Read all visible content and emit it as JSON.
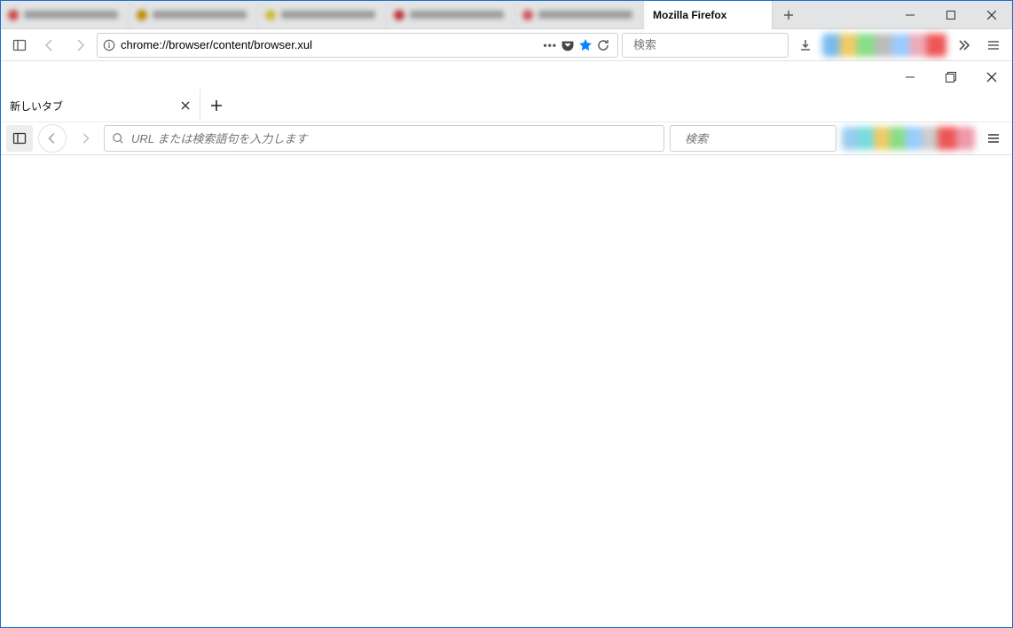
{
  "outer": {
    "active_tab_title": "Mozilla Firefox",
    "url": "chrome://browser/content/browser.xul",
    "search_placeholder": "検索"
  },
  "inner": {
    "tab_title": "新しいタブ",
    "url_placeholder": "URL または検索語句を入力します",
    "search_placeholder": "検索"
  }
}
